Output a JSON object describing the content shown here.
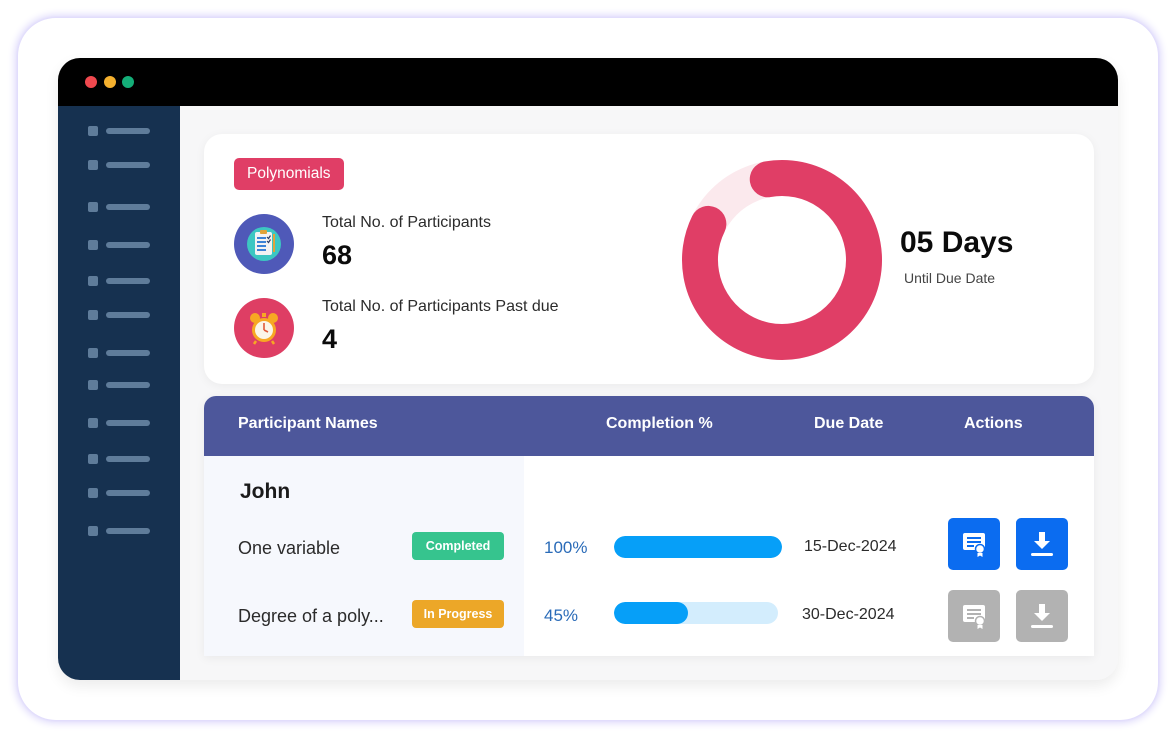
{
  "window": {
    "controls": [
      "close",
      "minimize",
      "maximize"
    ],
    "sidebar_items": 12
  },
  "summary": {
    "tag": "Polynomials",
    "stats": [
      {
        "icon": "checklist-icon",
        "label": "Total No. of Participants",
        "value": "68"
      },
      {
        "icon": "alarm-clock-icon",
        "label": "Total No. of Participants Past due",
        "value": "4"
      }
    ],
    "countdown": {
      "value": "05 Days",
      "caption": "Until Due Date",
      "ring_fraction_filled": 0.85,
      "ring_color": "#e03e66",
      "ring_track_color": "#fbe9ed"
    }
  },
  "table": {
    "headers": {
      "name": "Participant Names",
      "completion": "Completion %",
      "due": "Due Date",
      "actions": "Actions"
    },
    "participant": "John",
    "rows": [
      {
        "topic": "One variable",
        "status": "Completed",
        "status_color": "#36c48e",
        "completion_label": "100%",
        "completion": 100,
        "due_date": "15-Dec-2024",
        "actions_enabled": true,
        "actions": [
          "certificate-icon",
          "download-icon"
        ]
      },
      {
        "topic": "Degree of a poly...",
        "status": "In Progress",
        "status_color": "#eca728",
        "completion_label": "45%",
        "completion": 45,
        "due_date": "30-Dec-2024",
        "actions_enabled": false,
        "actions": [
          "certificate-icon",
          "download-icon"
        ]
      }
    ]
  }
}
